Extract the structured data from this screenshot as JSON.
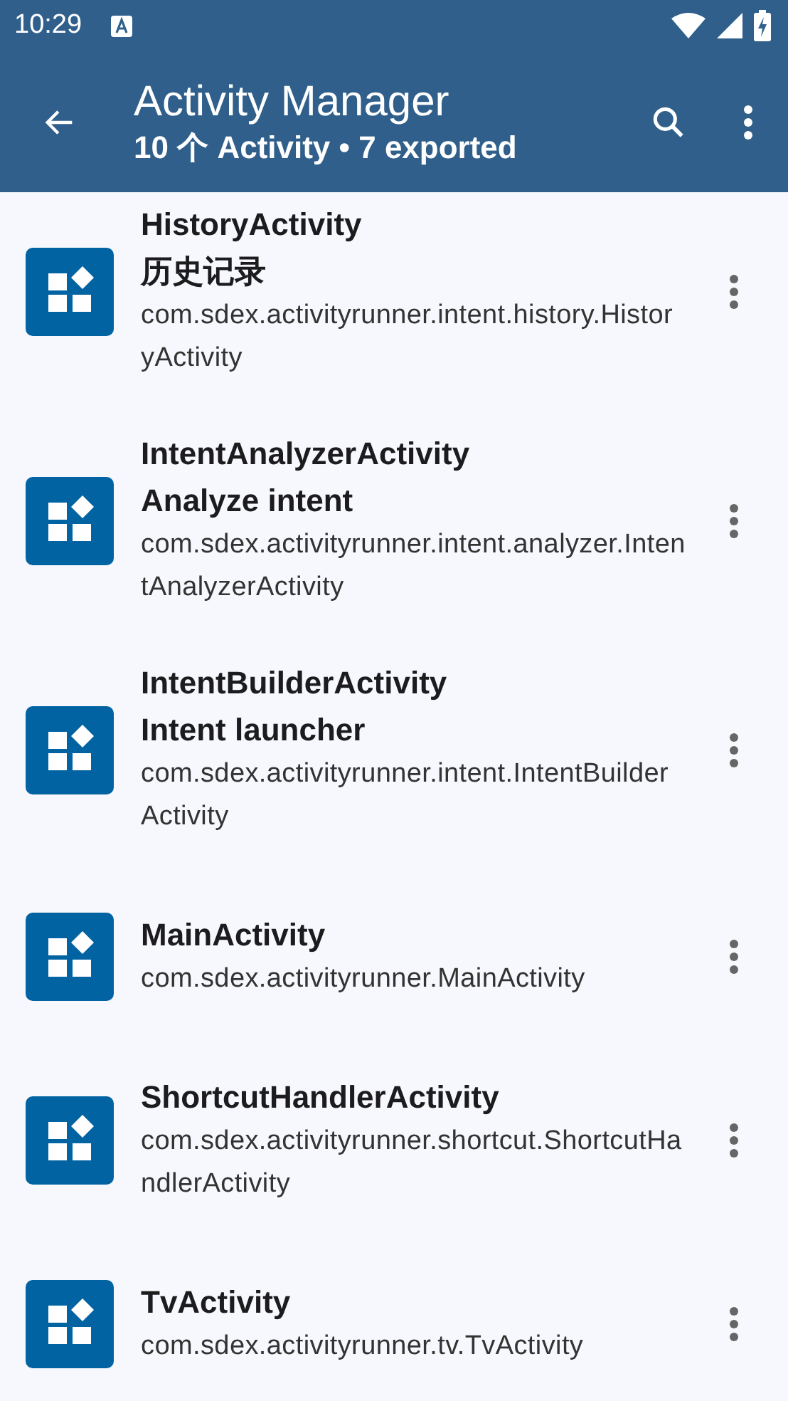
{
  "status_bar": {
    "time": "10:29"
  },
  "app_bar": {
    "title": "Activity Manager",
    "subtitle": "10 个 Activity • 7 exported"
  },
  "activities": [
    {
      "name": "HistoryActivity",
      "label": "历史记录",
      "class_name": "com.sdex.activityrunner.intent.history.HistoryActivity"
    },
    {
      "name": "IntentAnalyzerActivity",
      "label": "Analyze intent",
      "class_name": "com.sdex.activityrunner.intent.analyzer.IntentAnalyzerActivity"
    },
    {
      "name": "IntentBuilderActivity",
      "label": "Intent launcher",
      "class_name": "com.sdex.activityrunner.intent.IntentBuilderActivity"
    },
    {
      "name": "MainActivity",
      "class_name": "com.sdex.activityrunner.MainActivity"
    },
    {
      "name": "ShortcutHandlerActivity",
      "class_name": "com.sdex.activityrunner.shortcut.ShortcutHandlerActivity"
    },
    {
      "name": "TvActivity",
      "class_name": "com.sdex.activityrunner.tv.TvActivity"
    }
  ]
}
